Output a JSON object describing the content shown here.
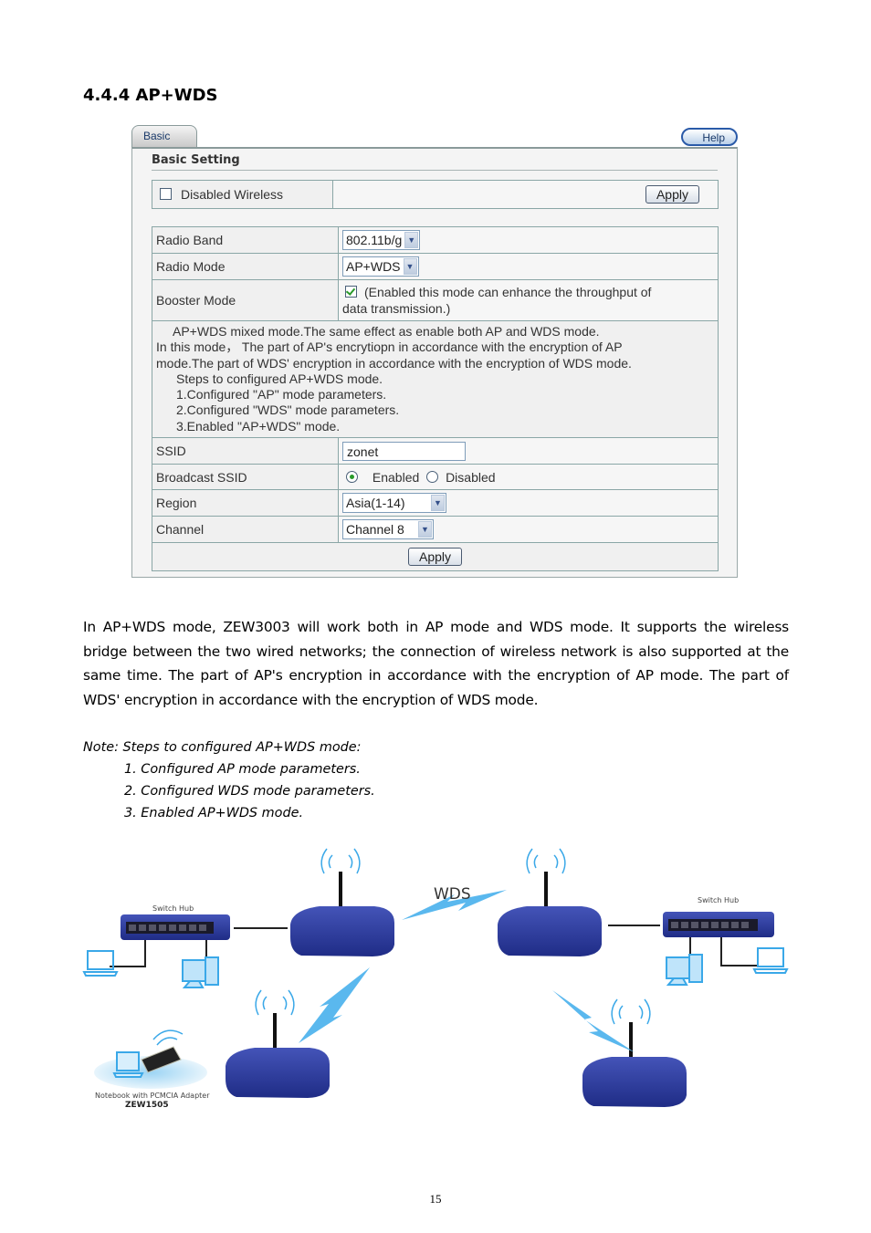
{
  "section": {
    "heading": "4.4.4 AP+WDS"
  },
  "panel": {
    "tab_label": "Basic",
    "help_label": "Help",
    "title": "Basic Setting",
    "disabled_wireless": {
      "label": "Disabled Wireless",
      "checked": false,
      "apply_label": "Apply"
    },
    "radio_band": {
      "label": "Radio Band",
      "value": "802.11b/g"
    },
    "radio_mode": {
      "label": "Radio Mode",
      "value": "AP+WDS"
    },
    "booster_mode": {
      "label": "Booster Mode",
      "checked": true,
      "text_line1": "(Enabled this mode can enhance the throughput of",
      "text_line2": "data transmission.)"
    },
    "description": [
      "AP+WDS mixed mode.The same effect as enable both AP and WDS mode.",
      "In this mode， The part of AP's encrytiopn in accordance with the encryption of AP",
      "mode.The part of WDS' encryption in accordance with the encryption of WDS mode.",
      "Steps to configured AP+WDS mode.",
      "1.Configured \"AP\" mode parameters.",
      "2.Configured \"WDS\" mode parameters.",
      "3.Enabled \"AP+WDS\" mode."
    ],
    "ssid": {
      "label": "SSID",
      "value": "zonet"
    },
    "broadcast_ssid": {
      "label": "Broadcast SSID",
      "enabled_label": "Enabled",
      "disabled_label": "Disabled",
      "selected": "Enabled"
    },
    "region": {
      "label": "Region",
      "value": "Asia(1-14)"
    },
    "channel": {
      "label": "Channel",
      "value": "Channel 8"
    },
    "apply_label": "Apply"
  },
  "body": {
    "paragraph": "In AP+WDS mode, ZEW3003 will work both in AP mode and WDS mode. It supports the wireless bridge between the two wired networks; the connection of wireless network is also supported at the same time. The part of AP's encryption in accordance with the encryption of AP mode. The part of WDS' encryption in accordance with the encryption of WDS mode.",
    "note_title": "Note: Steps to configured AP+WDS mode:",
    "note_steps": [
      "1. Configured AP mode parameters.",
      "2. Configured WDS mode parameters.",
      "3. Enabled AP+WDS mode."
    ]
  },
  "diagram": {
    "wds_label": "WDS",
    "switch_hub_label_left": "Switch Hub",
    "switch_hub_label_right": "Switch Hub",
    "notebook_caption": "Notebook with PCMCIA Adapter",
    "notebook_model": "ZEW1505",
    "colors": {
      "router": "#2b3a9a",
      "lightning": "#5ab8ee",
      "device": "#3aa8e8"
    }
  },
  "page_number": "15"
}
